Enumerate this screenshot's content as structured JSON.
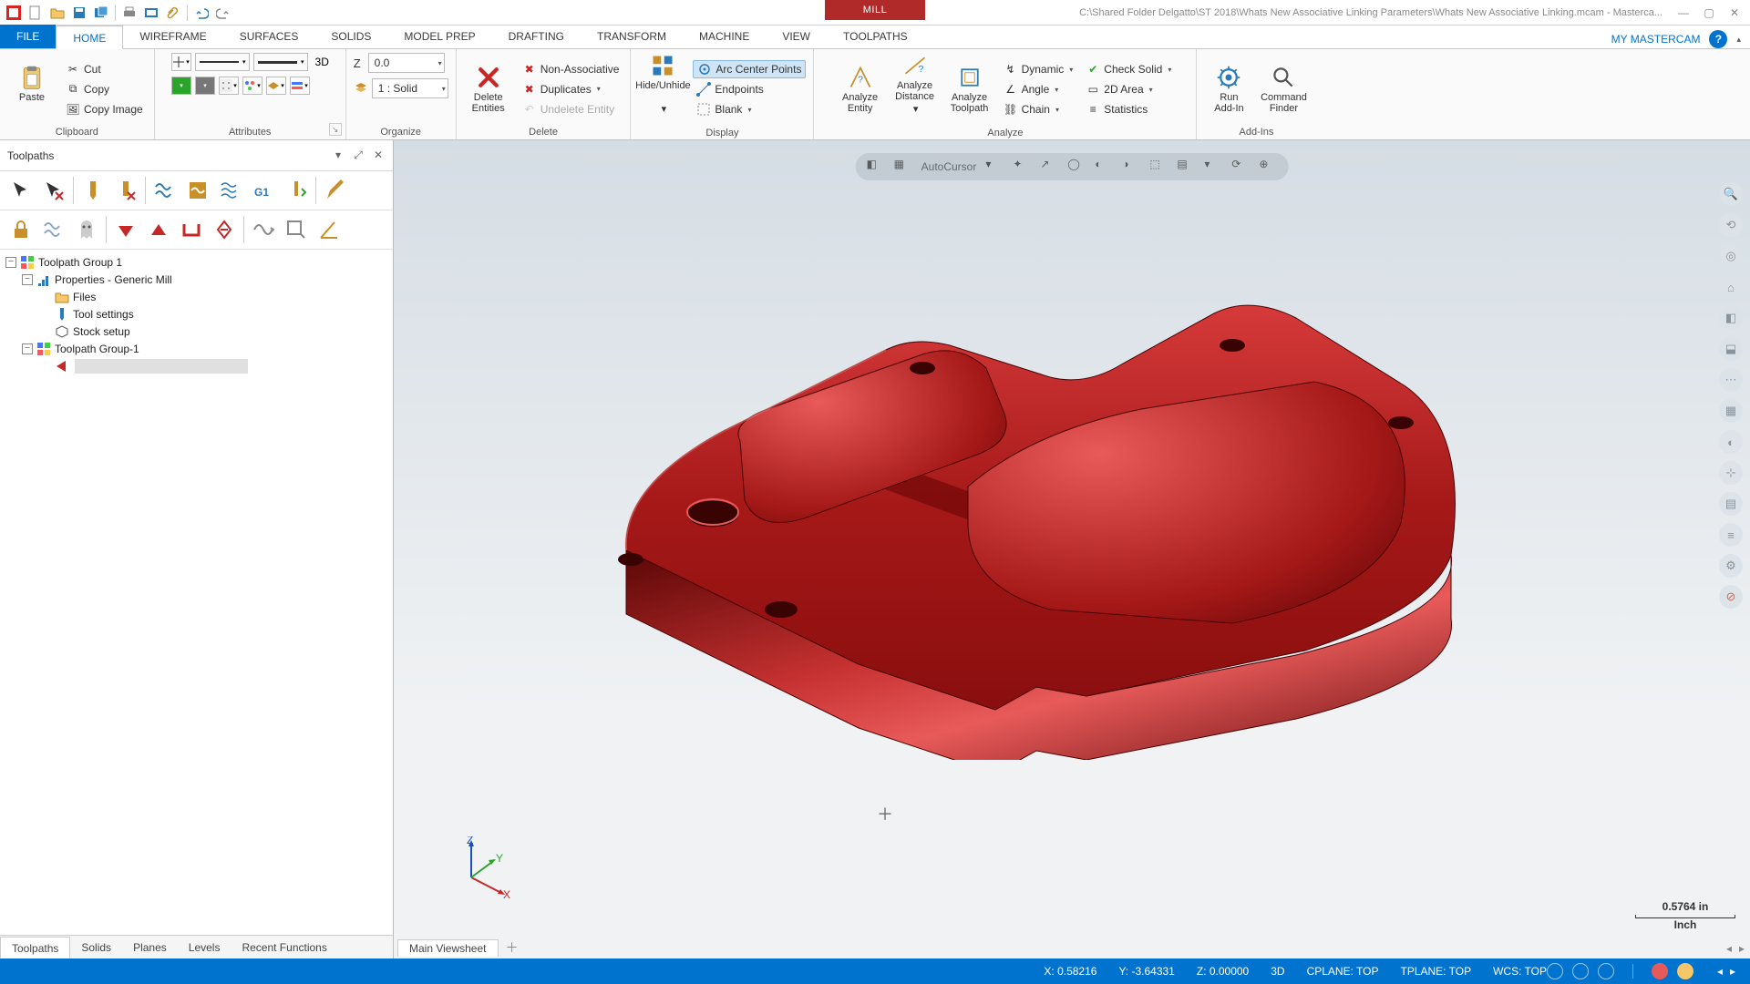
{
  "title_path": "C:\\Shared Folder Delgatto\\ST 2018\\Whats New Associative Linking Parameters\\Whats New Associative Linking.mcam - Masterca...",
  "context_tab": "MILL",
  "tabs": {
    "file": "FILE",
    "home": "HOME",
    "wireframe": "WIREFRAME",
    "surfaces": "SURFACES",
    "solids": "SOLIDS",
    "model_prep": "MODEL PREP",
    "drafting": "DRAFTING",
    "transform": "TRANSFORM",
    "machine": "MACHINE",
    "view": "VIEW",
    "toolpaths": "TOOLPATHS"
  },
  "my_mastercam": "MY MASTERCAM",
  "ribbon": {
    "clipboard": {
      "label": "Clipboard",
      "paste": "Paste",
      "cut": "Cut",
      "copy": "Copy",
      "copy_image": "Copy Image"
    },
    "attributes": {
      "label": "Attributes",
      "mode2d3d": "3D",
      "z_label": "Z",
      "z_val": "0.0",
      "level": "1 : Solid"
    },
    "organize": {
      "label": "Organize"
    },
    "delete": {
      "label": "Delete",
      "delete_entities": "Delete\nEntities",
      "non_assoc": "Non-Associative",
      "duplicates": "Duplicates",
      "undelete": "Undelete Entity"
    },
    "display": {
      "label": "Display",
      "hide": "Hide/Unhide",
      "arc": "Arc Center Points",
      "endpoints": "Endpoints",
      "blank": "Blank"
    },
    "analyze": {
      "label": "Analyze",
      "entity": "Analyze\nEntity",
      "distance": "Analyze\nDistance",
      "toolpath": "Analyze\nToolpath",
      "dynamic": "Dynamic",
      "angle": "Angle",
      "chain": "Chain",
      "check_solid": "Check Solid",
      "area2d": "2D Area",
      "statistics": "Statistics"
    },
    "addins": {
      "label": "Add-Ins",
      "run": "Run\nAdd-In",
      "cmd": "Command\nFinder"
    }
  },
  "panel": {
    "title": "Toolpaths"
  },
  "tree": {
    "n0": "Toolpath Group 1",
    "n1": "Properties - Generic Mill",
    "n2": "Files",
    "n3": "Tool settings",
    "n4": "Stock setup",
    "n5": "Toolpath Group-1"
  },
  "panel_tabs": [
    "Toolpaths",
    "Solids",
    "Planes",
    "Levels",
    "Recent Functions"
  ],
  "view_tab": "Main Viewsheet",
  "triad": {
    "x": "X",
    "y": "Y",
    "z": "Z"
  },
  "scale": {
    "val": "0.5764 in",
    "unit": "Inch"
  },
  "float_toolbar": "AutoCursor",
  "status": {
    "x": "X: 0.58216",
    "y": "Y: -3.64331",
    "z": "Z: 0.00000",
    "mode": "3D",
    "cplane": "CPLANE: TOP",
    "tplane": "TPLANE: TOP",
    "wcs": "WCS: TOP"
  }
}
